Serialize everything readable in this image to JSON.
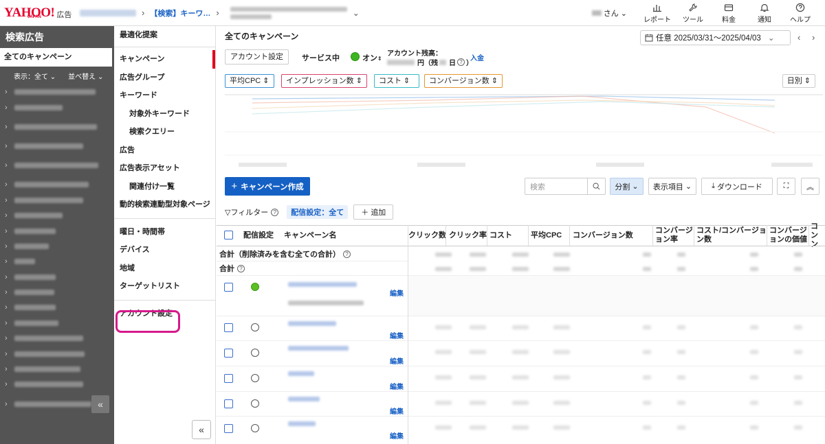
{
  "header": {
    "logo_text": "YAHOO!",
    "logo_sub": "JAPAN",
    "logo_ad": "広告",
    "breadcrumb_link": "【検索】キーワ…",
    "user_suffix": "さん",
    "nav": [
      {
        "label": "レポート",
        "icon": "bar-chart-icon"
      },
      {
        "label": "ツール",
        "icon": "wrench-icon"
      },
      {
        "label": "料金",
        "icon": "wallet-icon"
      },
      {
        "label": "通知",
        "icon": "bell-icon"
      },
      {
        "label": "ヘルプ",
        "icon": "question-icon"
      }
    ]
  },
  "sidebar": {
    "title": "検索広告",
    "all_campaigns": "全てのキャンペーン",
    "filter_display": "表示：全て",
    "filter_sort": "並べ替え"
  },
  "subnav": {
    "items": [
      {
        "label": "最適化提案"
      },
      {
        "label": "キャンペーン"
      },
      {
        "label": "広告グループ"
      },
      {
        "label": "キーワード"
      },
      {
        "label": "対象外キーワード"
      },
      {
        "label": "検索クエリー"
      },
      {
        "label": "広告"
      },
      {
        "label": "広告表示アセット"
      },
      {
        "label": "関連付け一覧"
      },
      {
        "label": "動的検索連動型対象ページ"
      },
      {
        "label": "曜日・時間帯"
      },
      {
        "label": "デバイス"
      },
      {
        "label": "地域"
      },
      {
        "label": "ターゲットリスト"
      },
      {
        "label": "アカウント設定"
      }
    ]
  },
  "main": {
    "title": "全てのキャンペーン",
    "date_range": "任意 2025/03/31〜2025/04/03",
    "account_settings_btn": "アカウント設定",
    "service_label": "サービス中",
    "on_label": "オン",
    "balance_label": "アカウント残高：",
    "balance_suffix": "円（残",
    "balance_end": "日",
    "deposit": "入金",
    "metrics": [
      {
        "label": "平均CPC",
        "color": "#3a8fd6"
      },
      {
        "label": "インプレッション数",
        "color": "#d8416b"
      },
      {
        "label": "コスト",
        "color": "#38b8c4"
      },
      {
        "label": "コンバージョン数",
        "color": "#e5962e"
      }
    ],
    "daily": "日別",
    "create_btn": "キャンペーン作成",
    "search_placeholder": "検索",
    "split_btn": "分割",
    "columns_btn": "表示項目",
    "download_btn": "ダウンロード",
    "filter_label": "フィルター",
    "filter_chip": "配信設定：全て",
    "add_btn": "追加"
  },
  "table": {
    "headers": {
      "status": "配信設定",
      "name": "キャンペーン名",
      "clicks": "クリック数",
      "ctr": "クリック率",
      "cost": "コスト",
      "avg_cpc": "平均CPC",
      "conversions": "コンバージョン数",
      "cvr_1": "コンバージ",
      "cvr_2": "ョン率",
      "cpa_1": "コスト/コンバージョ",
      "cpa_2": "ン数",
      "cv_value_1": "コンバージ",
      "cv_value_2": "ョンの価値",
      "next_1": "コン",
      "next_2": "ン"
    },
    "total_incl_deleted": "合計（削除済みを含む全ての合計）",
    "total": "合計",
    "edit_label": "編集"
  }
}
